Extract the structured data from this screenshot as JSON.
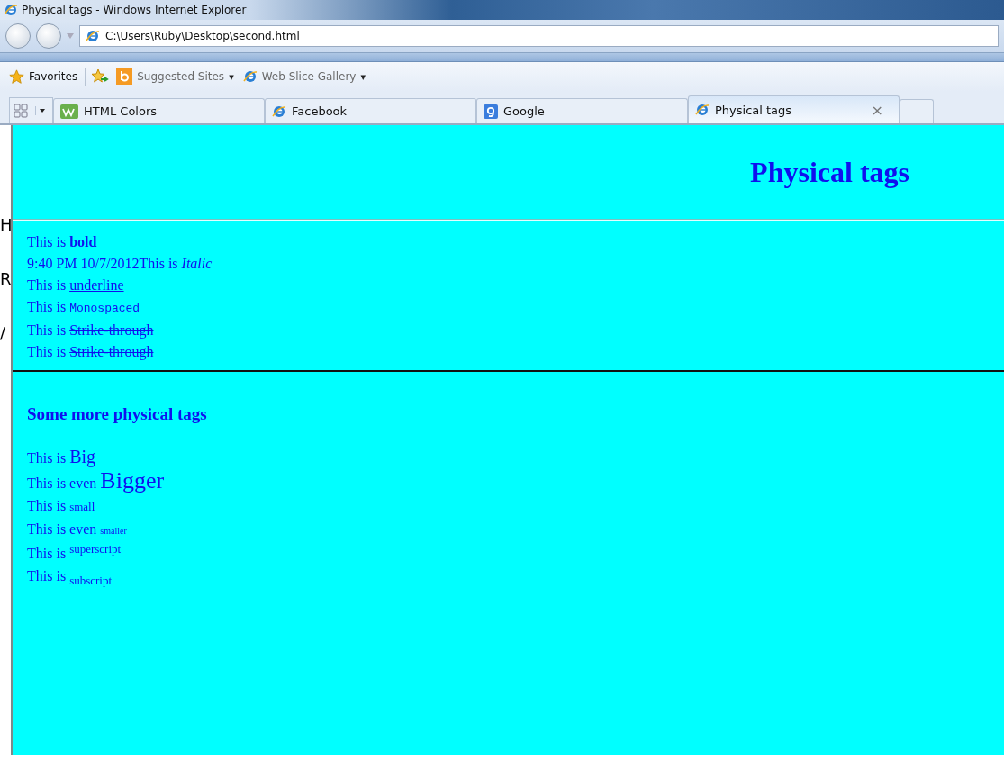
{
  "window": {
    "title": "Physical tags - Windows Internet Explorer"
  },
  "address_bar": {
    "value": "C:\\Users\\Ruby\\Desktop\\second.html"
  },
  "favorites_bar": {
    "items": [
      {
        "label": "Favorites",
        "kind": "favorites"
      },
      {
        "label": "Suggested Sites",
        "kind": "menu"
      },
      {
        "label": "Web Slice Gallery",
        "kind": "menu"
      }
    ],
    "caret": "▾"
  },
  "tabs": [
    {
      "label": "HTML Colors",
      "kind": "w3",
      "selected": false
    },
    {
      "label": "Facebook",
      "kind": "ie",
      "selected": false
    },
    {
      "label": "Google",
      "kind": "g",
      "selected": false
    },
    {
      "label": "Physical tags",
      "kind": "ie",
      "selected": true,
      "close": "×"
    }
  ],
  "background_fragments": [
    "H",
    "R",
    "/"
  ],
  "page": {
    "heading": "Physical tags",
    "lines": [
      {
        "prefix": "This is",
        "text": "bold",
        "kind": "bold"
      },
      {
        "prefix": "9:40 PM 10/7/2012This is",
        "text": "Italic",
        "kind": "italic"
      },
      {
        "prefix": "This is",
        "text": "underline",
        "kind": "underline"
      },
      {
        "prefix": "This is",
        "text": "Monospaced",
        "kind": "mono"
      },
      {
        "prefix": "This is",
        "text": "Strike-through",
        "kind": "strike"
      },
      {
        "prefix": "This is",
        "text": "Strike-through",
        "kind": "strike"
      }
    ],
    "subheading": "Some more physical tags",
    "more_lines": [
      {
        "prefix": "This is",
        "text": "Big",
        "kind": "big"
      },
      {
        "prefix": "This is even",
        "text": "Bigger",
        "kind": "bigger"
      },
      {
        "prefix": "This is",
        "text": "small",
        "kind": "small"
      },
      {
        "prefix": "This is even",
        "text": "smaller",
        "kind": "smaller"
      },
      {
        "prefix": "This is",
        "text": "superscript",
        "kind": "sup"
      },
      {
        "prefix": "This is",
        "text": "subscript",
        "kind": "sub"
      }
    ]
  }
}
